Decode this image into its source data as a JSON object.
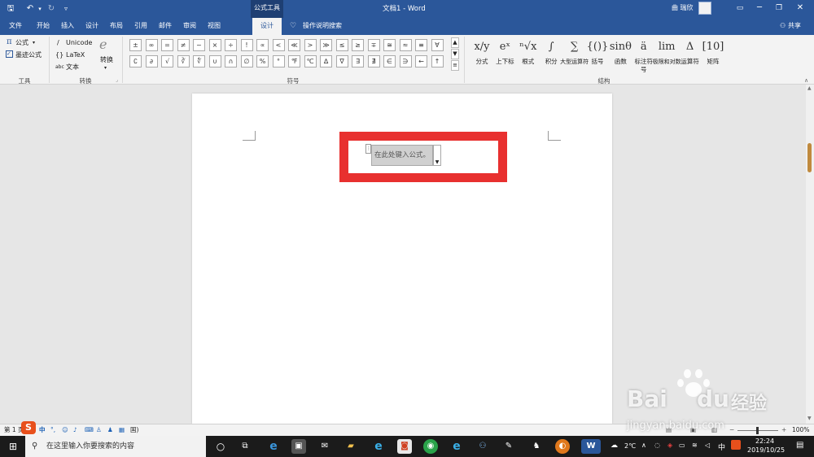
{
  "title_bar": {
    "doc_title": "文档1 - Word",
    "contextual_tab": "公式工具",
    "user": "曲 瑞欣"
  },
  "tabs": [
    "文件",
    "开始",
    "插入",
    "设计",
    "布局",
    "引用",
    "邮件",
    "审阅",
    "视图",
    "设计"
  ],
  "active_tab_index": 9,
  "tell_me": "操作说明搜索",
  "share": "共享",
  "ribbon": {
    "tools_group": {
      "equation": "公式",
      "ink_equation": "墨迹公式",
      "label": "工具"
    },
    "convert_group": {
      "unicode": "Unicode",
      "latex": "LaTeX",
      "text": "文本",
      "convert": "转换",
      "label": "转换"
    },
    "symbols_label": "符号",
    "symbols_row1": [
      "±",
      "∞",
      "=",
      "≠",
      "~",
      "×",
      "÷",
      "!",
      "∝",
      "<",
      "≪",
      ">",
      "≫",
      "≤",
      "≥",
      "∓",
      "≅",
      "≈",
      "≡",
      "∀"
    ],
    "symbols_row2": [
      "∁",
      "∂",
      "√",
      "∛",
      "∜",
      "∪",
      "∩",
      "∅",
      "%",
      "°",
      "℉",
      "℃",
      "∆",
      "∇",
      "∃",
      "∄",
      "∈",
      "∋",
      "←",
      "↑"
    ],
    "structures_label": "结构",
    "structures": [
      {
        "glyph": "x/y",
        "label": "分式"
      },
      {
        "glyph": "eˣ",
        "label": "上下标"
      },
      {
        "glyph": "ⁿ√x",
        "label": "根式"
      },
      {
        "glyph": "∫",
        "label": "积分"
      },
      {
        "glyph": "∑",
        "label": "大型运算符"
      },
      {
        "glyph": "{()}",
        "label": "括号"
      },
      {
        "glyph": "sinθ",
        "label": "函数"
      },
      {
        "glyph": "ä",
        "label": "标注符号"
      },
      {
        "glyph": "lim",
        "label": "极限和对数"
      },
      {
        "glyph": "Δ",
        "label": "运算符"
      },
      {
        "glyph": "[10]",
        "label": "矩阵"
      }
    ]
  },
  "document": {
    "equation_placeholder": "在此处键入公式。",
    "highlight_color": "#e8302f"
  },
  "status_bar": {
    "page": "第 1 页",
    "zoom": "100%",
    "lang_hint": "国)"
  },
  "ime": {
    "logo": "S",
    "mode": "中"
  },
  "taskbar": {
    "search_placeholder": "在这里输入你要搜索的内容",
    "temperature": "2℃",
    "ime_mode": "中",
    "time": "22:24",
    "date": "2019/10/25"
  },
  "watermark": {
    "brand": "Bai",
    "brand2": "du",
    "product": "经验",
    "url": "jingyan.baidu.com"
  }
}
